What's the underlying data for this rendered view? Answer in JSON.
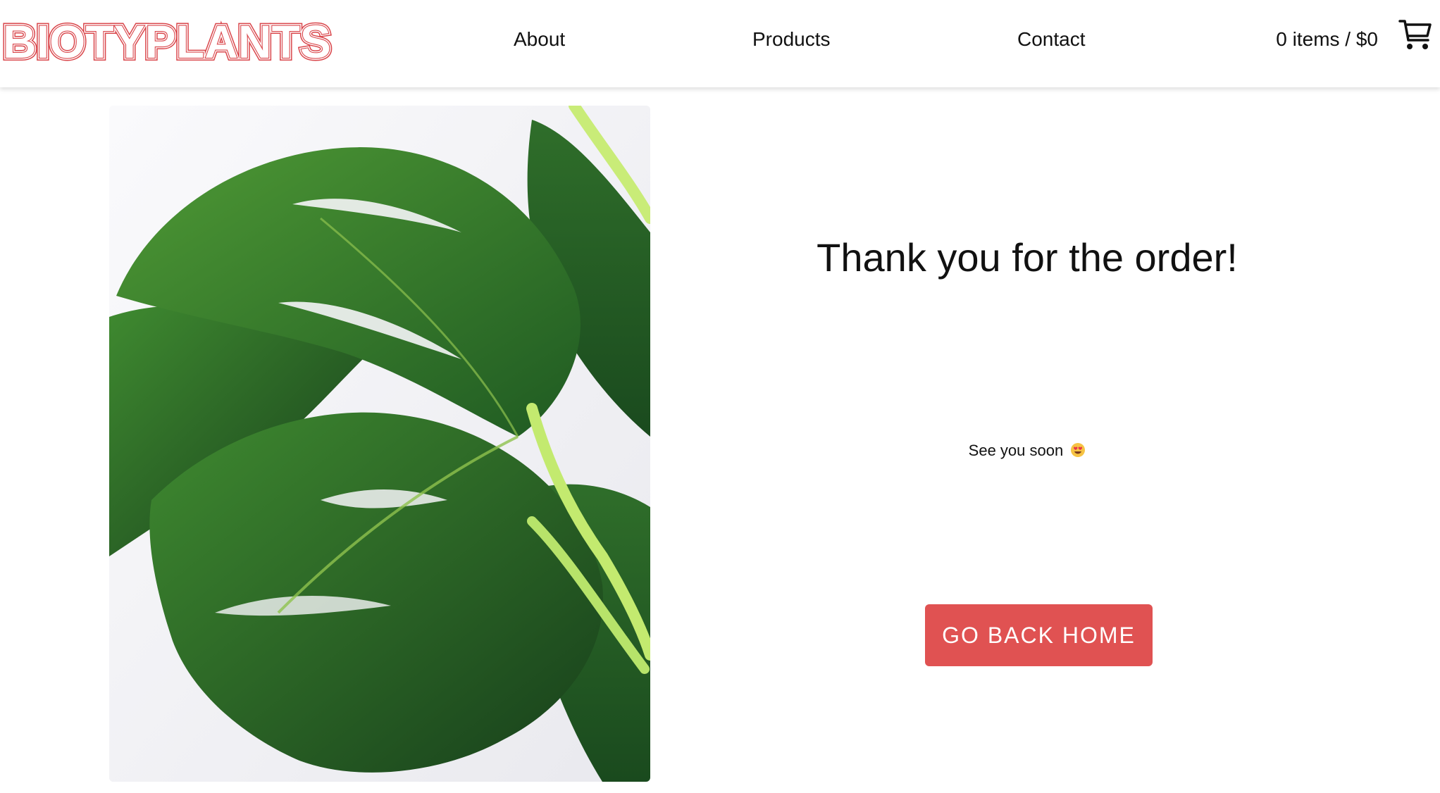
{
  "header": {
    "logo_text": "BIOTYPLANTS",
    "nav": {
      "about": "About",
      "products": "Products",
      "contact": "Contact"
    },
    "cart_summary": "0 items / $0"
  },
  "main": {
    "title": "Thank you for the order!",
    "message": "See you soon",
    "button_label": "GO BACK HOME"
  },
  "colors": {
    "brand": "#e05252",
    "logo_stroke": "#d9454a",
    "text": "#111111",
    "background": "#ffffff"
  },
  "icons": {
    "cart": "shopping-cart-icon",
    "emoji": "heart-eyes-emoji-icon"
  }
}
